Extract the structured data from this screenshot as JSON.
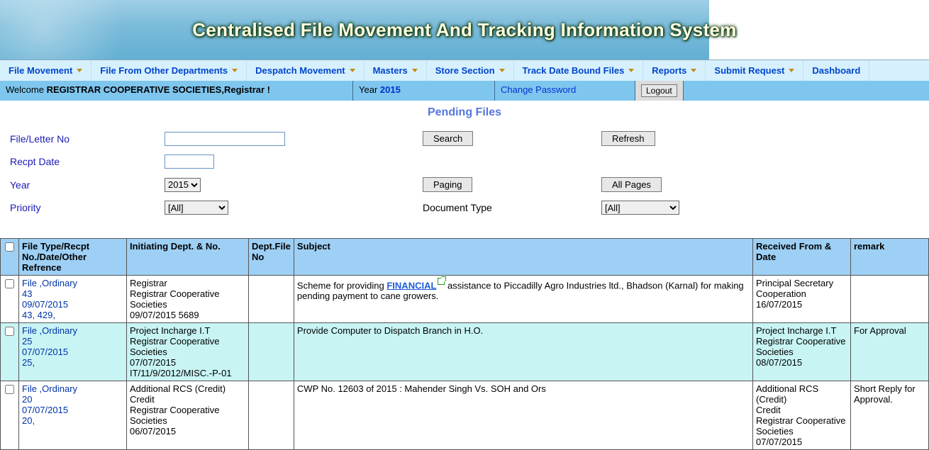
{
  "banner": {
    "title": "Centralised File Movement And  Tracking Information System"
  },
  "menu": {
    "file_movement": "File Movement",
    "file_from_other": "File From Other Departments",
    "despatch": "Despatch Movement",
    "masters": "Masters",
    "store": "Store Section",
    "track_date": "Track Date Bound Files",
    "reports": "Reports",
    "submit_req": "Submit Request",
    "dashboard": "Dashboard"
  },
  "infobar": {
    "welcome_prefix": "Welcome ",
    "welcome_user": "REGISTRAR COOPERATIVE SOCIETIES,Registrar !",
    "year_label": "Year ",
    "year_value": "2015",
    "change_password": "Change Password",
    "logout": "Logout"
  },
  "page": {
    "heading": "Pending Files"
  },
  "filters": {
    "file_no_label": "File/Letter No",
    "recpt_date_label": "Recpt Date",
    "year_label": "Year",
    "priority_label": "Priority",
    "doc_type_label": "Document Type",
    "search_btn": "Search",
    "refresh_btn": "Refresh",
    "paging_btn": "Paging",
    "all_pages_btn": "All Pages",
    "year_value": "2015",
    "priority_value": "[All]",
    "doc_type_value": "[All]"
  },
  "grid": {
    "headers": {
      "file_type": "File Type/Recpt No./Date/Other Refrence",
      "initiating": "Initiating Dept. & No.",
      "dept_file": "Dept.File No",
      "subject": "Subject",
      "received": "Received From & Date",
      "remark": "remark"
    },
    "rows": [
      {
        "file_l1": "File ,Ordinary",
        "file_l2": "43",
        "file_l3": "09/07/2015",
        "file_l4": "43, 429,",
        "init": "Registrar\nRegistrar Cooperative Societies\n09/07/2015 5689",
        "dept": "",
        "subj_pre": "Scheme for providing ",
        "subj_link": "FINANCIAL",
        "subj_post": "  assistance to Piccadilly Agro Industries ltd., Bhadson (Karnal) for making pending payment to cane growers.",
        "recv": "Principal Secretary Cooperation\n16/07/2015",
        "remark": ""
      },
      {
        "file_l1": "File ,Ordinary",
        "file_l2": "25",
        "file_l3": "07/07/2015",
        "file_l4": "25,",
        "init": "Project Incharge I.T\nRegistrar Cooperative Societies\n07/07/2015\nIT/11/9/2012/MISC.-P-01",
        "dept": "",
        "subj_pre": "Provide Computer to Dispatch Branch in H.O.",
        "subj_link": "",
        "subj_post": "",
        "recv": "Project Incharge I.T\nRegistrar Cooperative Societies\n08/07/2015",
        "remark": "For Approval"
      },
      {
        "file_l1": "File ,Ordinary",
        "file_l2": "20",
        "file_l3": "07/07/2015",
        "file_l4": "20,",
        "init": "Additional RCS (Credit)\nCredit\nRegistrar Cooperative Societies\n06/07/2015",
        "dept": "",
        "subj_pre": "CWP No. 12603 of 2015 : Mahender Singh Vs. SOH and Ors",
        "subj_link": "",
        "subj_post": "",
        "recv": "Additional RCS (Credit)\nCredit\nRegistrar Cooperative Societies\n07/07/2015",
        "remark": "Short Reply for Approval."
      }
    ]
  }
}
